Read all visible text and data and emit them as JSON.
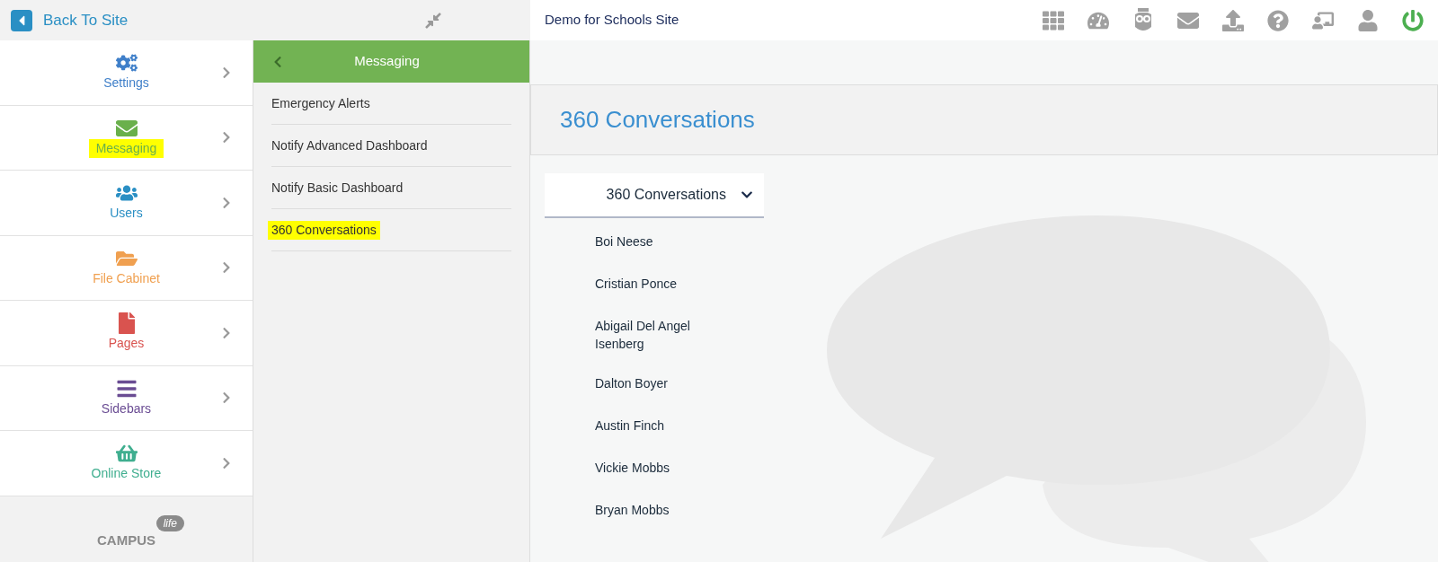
{
  "back_link": {
    "label": "Back To Site"
  },
  "nav": [
    {
      "label": "Settings",
      "color": "#3f7fc9",
      "highlighted": false
    },
    {
      "label": "Messaging",
      "color": "#6ab04c",
      "highlighted": true
    },
    {
      "label": "Users",
      "color": "#2a8fc4",
      "highlighted": false
    },
    {
      "label": "File Cabinet",
      "color": "#f0a050",
      "highlighted": false
    },
    {
      "label": "Pages",
      "color": "#d9534f",
      "highlighted": false
    },
    {
      "label": "Sidebars",
      "color": "#6a4c93",
      "highlighted": false
    },
    {
      "label": "Online Store",
      "color": "#3fae8f",
      "highlighted": false
    }
  ],
  "logo": {
    "word": "CAMPUS",
    "tag": "life"
  },
  "submenu": {
    "title": "Messaging",
    "items": [
      {
        "label": "Emergency Alerts",
        "highlighted": false
      },
      {
        "label": "Notify Advanced Dashboard",
        "highlighted": false
      },
      {
        "label": "Notify Basic Dashboard",
        "highlighted": false
      },
      {
        "label": "360 Conversations",
        "highlighted": true
      }
    ]
  },
  "site_title": "Demo for Schools Site",
  "page_title": "360 Conversations",
  "conversation_dropdown": {
    "value": "360 Conversations",
    "expanded": true,
    "people": [
      "Boi Neese",
      "Cristian Ponce",
      "Abigail Del Angel Isenberg",
      "Dalton Boyer",
      "Austin Finch",
      "Vickie Mobbs",
      "Bryan Mobbs"
    ]
  }
}
